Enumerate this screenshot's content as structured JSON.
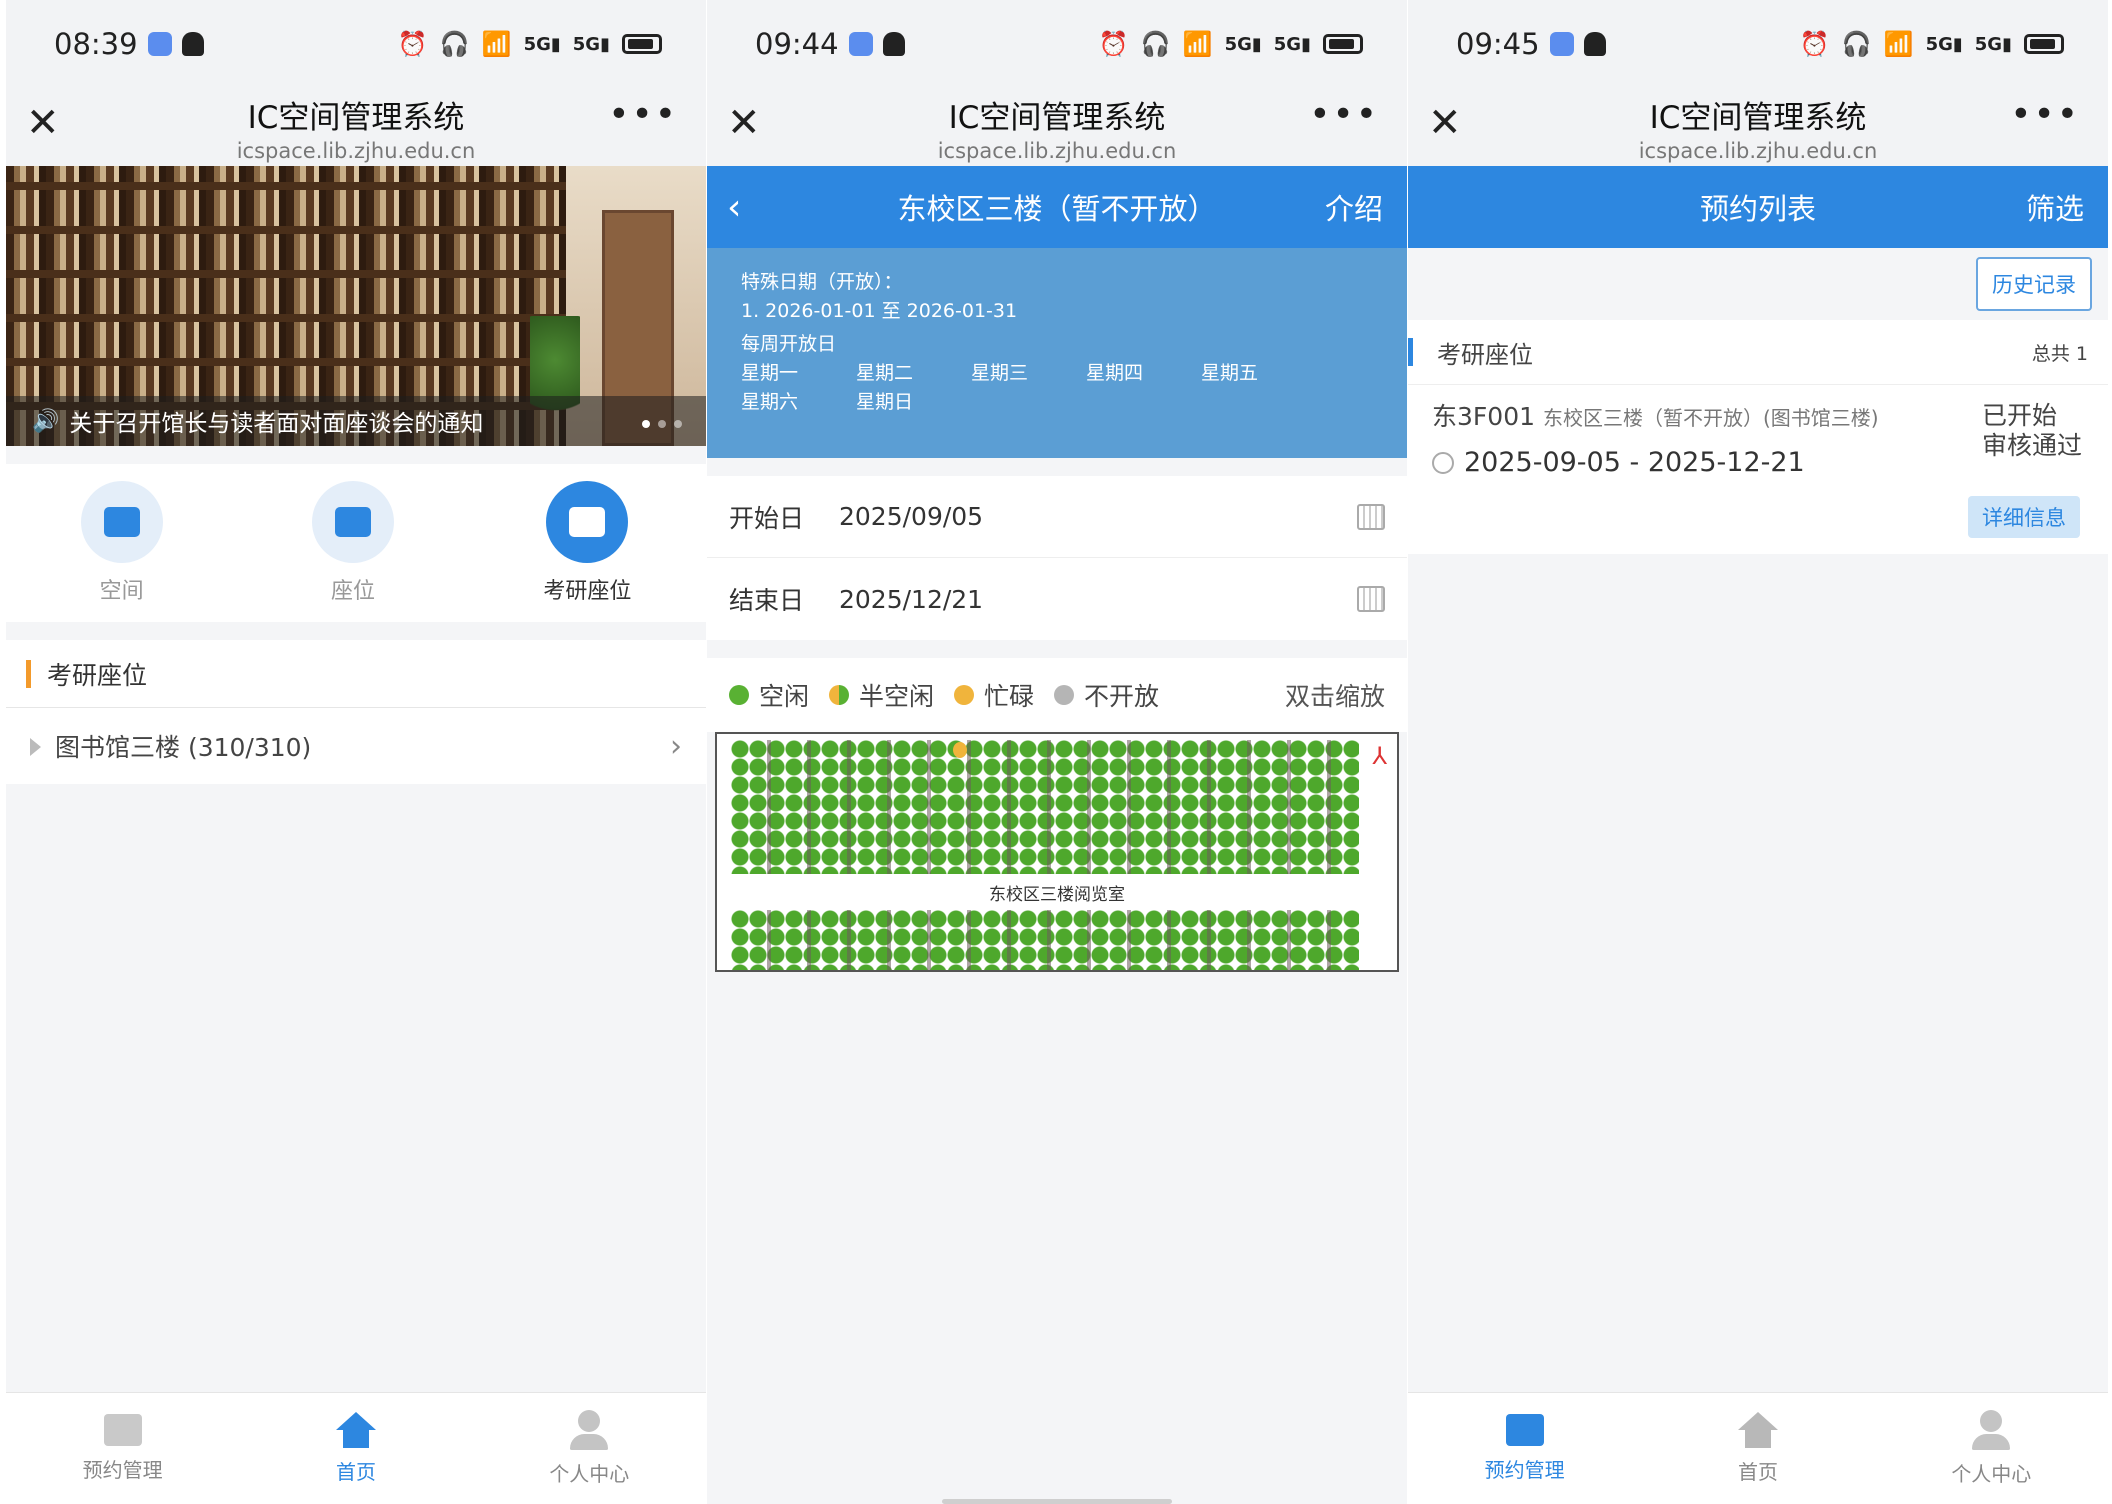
{
  "phone1": {
    "time": "08:39",
    "app_title": "IC空间管理系统",
    "app_domain": "icspace.lib.zjhu.edu.cn",
    "banner_caption": "关于召开馆长与读者面对面座谈会的通知",
    "categories": [
      "空间",
      "座位",
      "考研座位"
    ],
    "section_title": "考研座位",
    "location_row": "图书馆三楼 (310/310)",
    "tabs": [
      "预约管理",
      "首页",
      "个人中心"
    ],
    "active_tab": "首页"
  },
  "phone2": {
    "time": "09:44",
    "app_title": "IC空间管理系统",
    "app_domain": "icspace.lib.zjhu.edu.cn",
    "header_title": "东校区三楼（暂不开放）",
    "header_right": "介绍",
    "special_date_label": "特殊日期（开放）：",
    "special_date_item": "1. 2026-01-01 至 2026-01-31",
    "weekly_label": "每周开放日",
    "weekdays": [
      "星期一",
      "星期二",
      "星期三",
      "星期四",
      "星期五",
      "星期六",
      "星期日"
    ],
    "start_label": "开始日",
    "start_value": "2025/09/05",
    "end_label": "结束日",
    "end_value": "2025/12/21",
    "legend": [
      "空闲",
      "半空闲",
      "忙碌",
      "不开放"
    ],
    "legend_colors": [
      "#59b133",
      "#59b133/#f0b43c",
      "#f0b43c",
      "#b5b5b5"
    ],
    "zoom_hint": "双击缩放",
    "room_label": "东校区三楼阅览室"
  },
  "phone3": {
    "time": "09:45",
    "app_title": "IC空间管理系统",
    "app_domain": "icspace.lib.zjhu.edu.cn",
    "header_title": "预约列表",
    "header_right": "筛选",
    "history_button": "历史记录",
    "section_title": "考研座位",
    "total": "总共 1",
    "seat_id": "东3F001",
    "seat_location": "东校区三楼（暂不开放）(图书馆三楼)",
    "date_range": "2025-09-05 - 2025-12-21",
    "status_line1": "已开始",
    "status_line2": "审核通过",
    "detail_button": "详细信息",
    "tabs": [
      "预约管理",
      "首页",
      "个人中心"
    ],
    "active_tab": "预约管理"
  },
  "colors": {
    "primary_blue": "#2d87e0",
    "info_blue": "#5b9ed4",
    "accent_orange": "#f39a2b",
    "seat_free": "#59b133",
    "seat_busy": "#f0b43c"
  }
}
